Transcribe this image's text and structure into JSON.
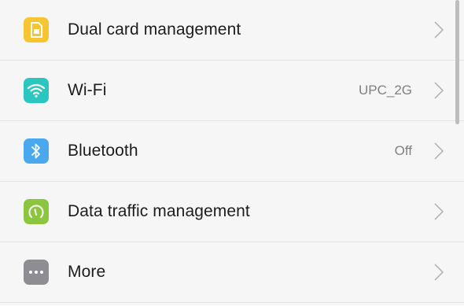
{
  "colors": {
    "sim_icon": "#f7c531",
    "wifi_icon": "#2cc6c0",
    "bluetooth_icon": "#4aa8ef",
    "data_icon": "#8cc63f",
    "more_icon": "#8d8d93"
  },
  "settings": {
    "items": [
      {
        "label": "Dual card management",
        "value": "",
        "icon": "sim-card-icon"
      },
      {
        "label": "Wi-Fi",
        "value": "UPC_2G",
        "icon": "wifi-icon"
      },
      {
        "label": "Bluetooth",
        "value": "Off",
        "icon": "bluetooth-icon"
      },
      {
        "label": "Data traffic management",
        "value": "",
        "icon": "data-gauge-icon"
      },
      {
        "label": "More",
        "value": "",
        "icon": "more-dots-icon"
      }
    ]
  }
}
